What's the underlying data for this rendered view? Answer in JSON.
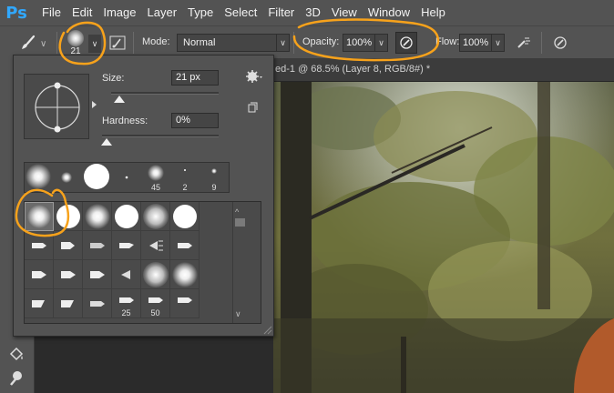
{
  "app": {
    "logo": "Ps"
  },
  "menu": [
    "File",
    "Edit",
    "Image",
    "Layer",
    "Type",
    "Select",
    "Filter",
    "3D",
    "View",
    "Window",
    "Help"
  ],
  "options": {
    "brush_size": "21",
    "mode_label": "Mode:",
    "mode_value": "Normal",
    "opacity_label": "Opacity:",
    "opacity_value": "100%",
    "flow_label": "Flow:",
    "flow_value": "100%"
  },
  "document": {
    "tab_title": "ed-1 @ 68.5% (Layer 8, RGB/8#) *"
  },
  "picker": {
    "size_label": "Size:",
    "size_value": "21 px",
    "hardness_label": "Hardness:",
    "hardness_value": "0%",
    "size_level": 0.08,
    "hardness_level": 0.0,
    "recent_numbers": [
      "45",
      "2",
      "9"
    ],
    "grid_numbers": [
      "25",
      "50"
    ]
  },
  "colors": {
    "chrome": "#535353",
    "annotation": "#f7a21b",
    "ps_blue": "#31a8ff"
  }
}
